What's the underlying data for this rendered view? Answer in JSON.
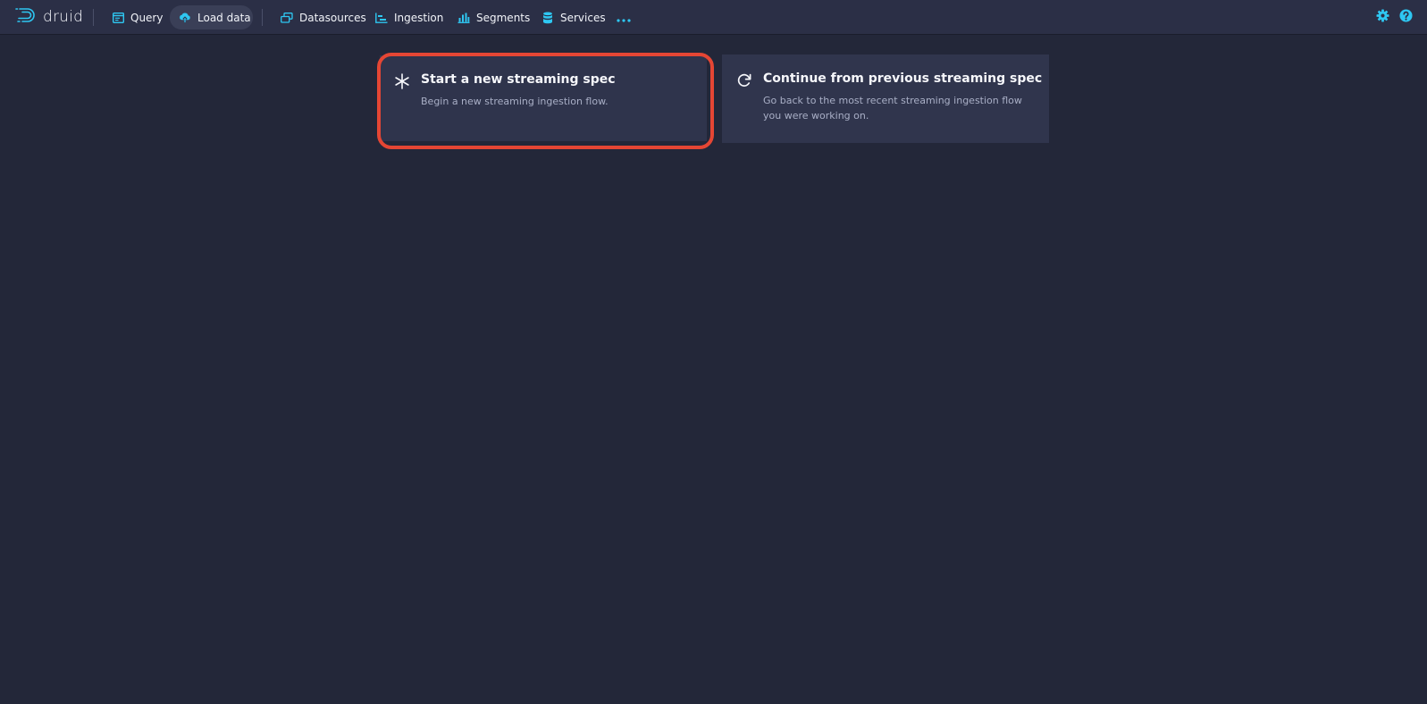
{
  "app": {
    "brand_name": "druid",
    "brand_icon": "druid-logo-icon"
  },
  "nav": {
    "items": [
      {
        "label": "Query",
        "icon": "query-icon",
        "active": false
      },
      {
        "label": "Load data",
        "icon": "cloud-upload-icon",
        "active": true
      },
      {
        "label": "Datasources",
        "icon": "datasources-icon",
        "active": false
      },
      {
        "label": "Ingestion",
        "icon": "ingestion-icon",
        "active": false
      },
      {
        "label": "Segments",
        "icon": "segments-icon",
        "active": false
      },
      {
        "label": "Services",
        "icon": "services-icon",
        "active": false
      }
    ],
    "more_icon": "more-icon",
    "settings_icon": "gear-icon",
    "help_icon": "help-icon"
  },
  "cards": {
    "new_spec": {
      "title": "Start a new streaming spec",
      "description": "Begin a new streaming ingestion flow.",
      "icon": "asterisk-icon",
      "highlighted": true
    },
    "continue_spec": {
      "title": "Continue from previous streaming spec",
      "description": "Go back to the most recent streaming ingestion flow you were working on.",
      "icon": "refresh-icon"
    }
  },
  "colors": {
    "background": "#232739",
    "navbar": "#2b2f46",
    "card": "#30354d",
    "accent": "#2ec7f2",
    "highlight": "#e54634",
    "text": "#f2f4f7",
    "muted_text": "#a9afc6"
  }
}
